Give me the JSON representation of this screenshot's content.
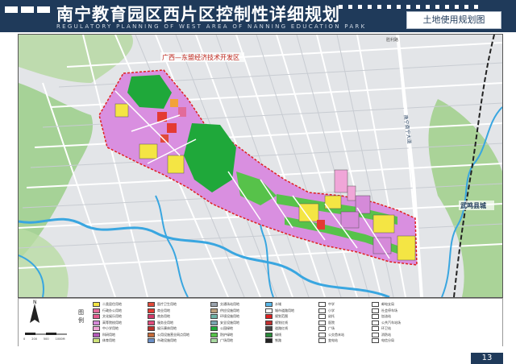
{
  "header": {
    "title": "南宁教育园区西片区控制性详细规划",
    "subtitle": "REGULATORY PLANNING OF WEST AREA OF NANNING EDUCATION PARK",
    "section": "土地使用规划图"
  },
  "map": {
    "labels": {
      "zone": "广西—东盟经济技术开发区",
      "wuming": "武鸣县城",
      "road_east": "南宁南宁大道",
      "corner_road": "胜利路"
    }
  },
  "legend": {
    "title": "图例",
    "scale_labels": [
      "0",
      "200",
      "500",
      "1000M"
    ],
    "items": [
      {
        "label": "二类居住用地",
        "color": "#f4e544"
      },
      {
        "label": "行政办公用地",
        "color": "#e26b9a"
      },
      {
        "label": "文化娱乐用地",
        "color": "#e35a8e"
      },
      {
        "label": "高等院校用地",
        "color": "#d58ad9"
      },
      {
        "label": "中小学用地",
        "color": "#f0a6d8"
      },
      {
        "label": "科研用地",
        "color": "#b35ab8"
      },
      {
        "label": "体育用地",
        "color": "#cfe37a"
      },
      {
        "label": "医疗卫生用地",
        "color": "#e14a3a"
      },
      {
        "label": "商业用地",
        "color": "#e43a32"
      },
      {
        "label": "商务用地",
        "color": "#d23a6a"
      },
      {
        "label": "服务业用地",
        "color": "#e04b7c"
      },
      {
        "label": "娱乐康体用地",
        "color": "#b8322c"
      },
      {
        "label": "公用设施营业网点用地",
        "color": "#c56b3a"
      },
      {
        "label": "市政设施用地",
        "color": "#6a8fc7"
      },
      {
        "label": "交通场站用地",
        "color": "#9aa3ad"
      },
      {
        "label": "供应设施用地",
        "color": "#bda07c"
      },
      {
        "label": "环境设施用地",
        "color": "#6fb3a6"
      },
      {
        "label": "安全设施用地",
        "color": "#7aa6b0"
      },
      {
        "label": "公园绿地",
        "color": "#1fa83a"
      },
      {
        "label": "防护绿地",
        "color": "#57c24a"
      },
      {
        "label": "广场用地",
        "color": "#a8d8a0"
      },
      {
        "label": "水域",
        "color": "#59b7e8"
      },
      {
        "label": "城市道路用地",
        "color": "#ffffff"
      },
      {
        "label": "规划范围",
        "color": "#e02020"
      },
      {
        "label": "规划红线",
        "color": "#c03030"
      },
      {
        "label": "道路红线",
        "color": "#444444"
      },
      {
        "label": "绿线",
        "color": "#2a8a3a"
      },
      {
        "label": "铁路",
        "color": "#222222"
      },
      {
        "label": "中学",
        "color": "#ffffff"
      },
      {
        "label": "小学",
        "color": "#ffffff"
      },
      {
        "label": "幼托",
        "color": "#ffffff"
      },
      {
        "label": "医院",
        "color": "#ffffff"
      },
      {
        "label": "广场",
        "color": "#ffffff"
      },
      {
        "label": "公交首末站",
        "color": "#ffffff"
      },
      {
        "label": "变电站",
        "color": "#ffffff"
      },
      {
        "label": "邮电支局",
        "color": "#ffffff"
      },
      {
        "label": "社会停车场",
        "color": "#ffffff"
      },
      {
        "label": "加油站",
        "color": "#ffffff"
      },
      {
        "label": "公共汽车站场",
        "color": "#ffffff"
      },
      {
        "label": "环卫站",
        "color": "#ffffff"
      },
      {
        "label": "消防站",
        "color": "#ffffff"
      },
      {
        "label": "电信分局",
        "color": "#ffffff"
      }
    ]
  },
  "footer": {
    "page": "13"
  }
}
